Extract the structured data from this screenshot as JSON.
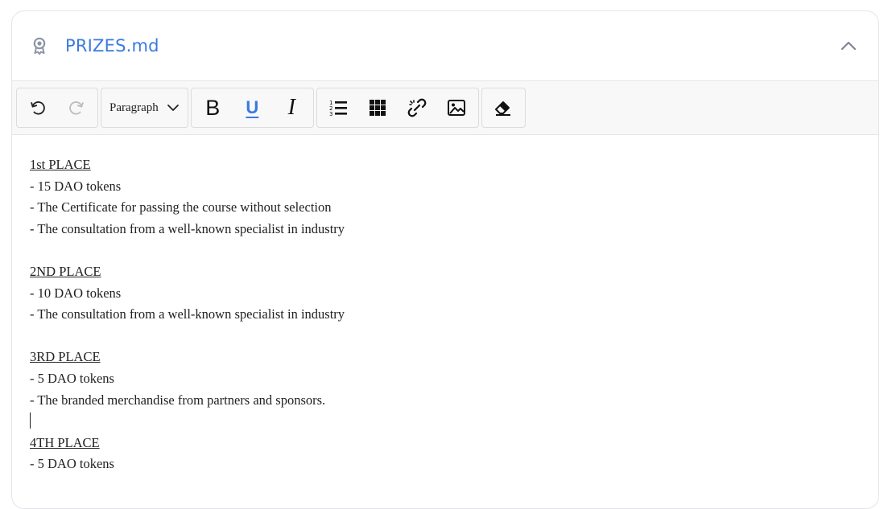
{
  "file": {
    "name": "PRIZES.md",
    "icon": "award-icon",
    "accent_color": "#3a7ae0"
  },
  "toolbar": {
    "undo_icon": "undo-icon",
    "redo_icon": "redo-icon",
    "block_type": "Paragraph",
    "bold_label": "B",
    "underline_label": "U",
    "italic_label": "I",
    "list_icon": "numbered-list-icon",
    "table_icon": "table-icon",
    "unlink_icon": "unlink-icon",
    "image_icon": "image-icon",
    "clear_format_icon": "eraser-icon"
  },
  "content": {
    "lines": [
      {
        "text": "1st PLACE",
        "underline": true
      },
      {
        "text": "- 15 DAO tokens"
      },
      {
        "text": "- The Certificate for passing the course without selection"
      },
      {
        "text": "- The consultation from a well-known specialist in industry"
      },
      {
        "text": ""
      },
      {
        "text": "2ND PLACE",
        "underline": true
      },
      {
        "text": "- 10 DAO tokens"
      },
      {
        "text": "- The consultation from a well-known specialist in industry"
      },
      {
        "text": ""
      },
      {
        "text": "3RD PLACE",
        "underline": true
      },
      {
        "text": "- 5 DAO tokens"
      },
      {
        "text": "- The branded merchandise from partners and sponsors."
      },
      {
        "text": "",
        "caret": true
      },
      {
        "text": "4TH PLACE",
        "underline": true
      },
      {
        "text": "- 5 DAO tokens"
      }
    ]
  }
}
